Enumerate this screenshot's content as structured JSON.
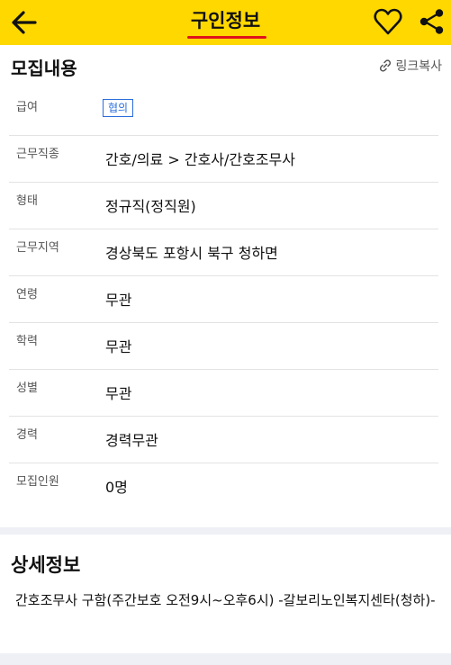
{
  "header": {
    "title": "구인정보",
    "back_icon": "back-arrow-icon",
    "favorite_icon": "heart-icon",
    "share_icon": "share-icon",
    "underline_color": "#e0121b",
    "bar_color": "#ffd800"
  },
  "recruit": {
    "section_title": "모집내용",
    "copy_link_label": "링크복사",
    "rows": [
      {
        "label": "급여",
        "value": "협의",
        "badge": true
      },
      {
        "label": "근무직종",
        "value": "간호/의료 > 간호사/간호조무사"
      },
      {
        "label": "형태",
        "value": "정규직(정직원)"
      },
      {
        "label": "근무지역",
        "value": "경상북도 포항시 북구 청하면"
      },
      {
        "label": "연령",
        "value": "무관"
      },
      {
        "label": "학력",
        "value": "무관"
      },
      {
        "label": "성별",
        "value": "무관"
      },
      {
        "label": "경력",
        "value": "경력무관"
      },
      {
        "label": "모집인원",
        "value": "0명"
      }
    ]
  },
  "detail": {
    "section_title": "상세정보",
    "text": "간호조무사 구함(주간보호 오전9시~오후6시) -갈보리노인복지센타(청하)-"
  }
}
